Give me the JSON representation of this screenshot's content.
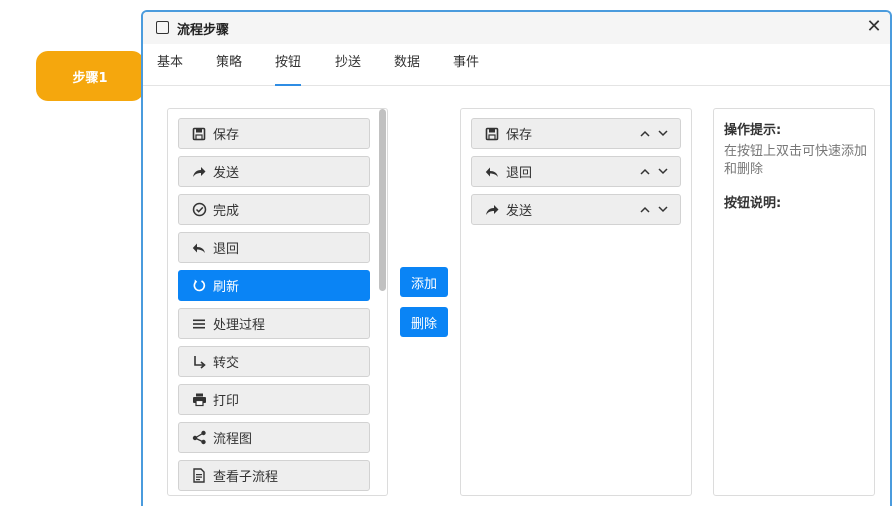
{
  "step_node": {
    "label": "步骤1"
  },
  "dialog": {
    "title": "流程步骤"
  },
  "tabs": [
    {
      "label": "基本"
    },
    {
      "label": "策略"
    },
    {
      "label": "按钮"
    },
    {
      "label": "抄送"
    },
    {
      "label": "数据"
    },
    {
      "label": "事件"
    }
  ],
  "active_tab": "按钮",
  "available_buttons": [
    {
      "label": "保存",
      "icon": "save-icon"
    },
    {
      "label": "发送",
      "icon": "send-icon"
    },
    {
      "label": "完成",
      "icon": "check-circle-icon"
    },
    {
      "label": "退回",
      "icon": "reply-icon"
    },
    {
      "label": "刷新",
      "icon": "refresh-icon",
      "selected": true
    },
    {
      "label": "处理过程",
      "icon": "list-icon"
    },
    {
      "label": "转交",
      "icon": "turn-right-icon"
    },
    {
      "label": "打印",
      "icon": "printer-icon"
    },
    {
      "label": "流程图",
      "icon": "share-nodes-icon"
    },
    {
      "label": "查看子流程",
      "icon": "document-icon"
    }
  ],
  "actions": {
    "add": "添加",
    "delete": "删除"
  },
  "selected_buttons": [
    {
      "label": "保存",
      "icon": "save-icon"
    },
    {
      "label": "退回",
      "icon": "reply-icon"
    },
    {
      "label": "发送",
      "icon": "send-icon"
    }
  ],
  "tips": {
    "title": "操作提示:",
    "text": "在按钮上双击可快速添加和删除",
    "desc_title": "按钮说明:"
  },
  "colors": {
    "accent": "#0a84f5",
    "step_node": "#f5a70d",
    "dialog_border": "#4a9bdd"
  }
}
